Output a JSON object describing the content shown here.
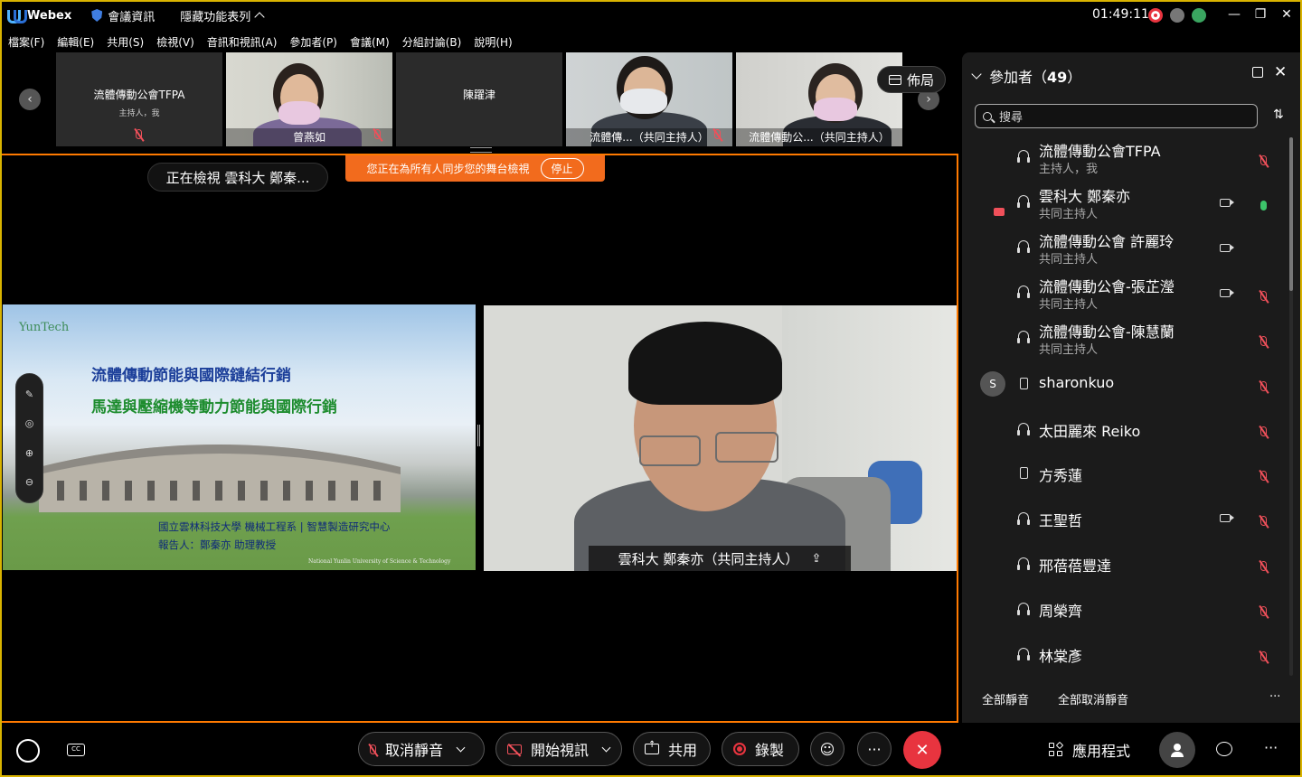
{
  "titlebar": {
    "app_name": "Webex",
    "meeting_info": "會議資訊",
    "hide_menu": "隱藏功能表列",
    "clock": "01:49:11"
  },
  "menu": [
    "檔案(F)",
    "編輯(E)",
    "共用(S)",
    "檢視(V)",
    "音訊和視訊(A)",
    "參加者(P)",
    "會議(M)",
    "分組討論(B)",
    "說明(H)"
  ],
  "thumbnails": [
    {
      "name": "流體傳動公會TFPA",
      "sub": "主持人，我"
    },
    {
      "name": "曾燕如"
    },
    {
      "name": "陳躍津"
    },
    {
      "name": "流體傳...（共同主持人）"
    },
    {
      "name": "流體傳動公...（共同主持人）"
    }
  ],
  "layout_button": "佈局",
  "stage": {
    "viewing_pill": "正在檢視 雲科大 鄭秦...",
    "sync_banner": "您正在為所有人同步您的舞台檢視",
    "stop_label": "停止"
  },
  "slide": {
    "logo": "YunTech",
    "title1": "流體傳動節能與國際鏈結行銷",
    "title2": "馬達與壓縮機等動力節能與國際行銷",
    "info1": "國立雲林科技大學 機械工程系 | 智慧製造研究中心",
    "info2": "報告人：鄭秦亦 助理教授",
    "footer": "National Yunlin University of Science & Technology"
  },
  "video": {
    "name_label": "雲科大 鄭秦亦（共同主持人）"
  },
  "participants": {
    "header": "參加者（",
    "count": "49",
    "header_close": "）",
    "search_placeholder": "搜尋",
    "list": [
      {
        "name": "流體傳動公會TFPA",
        "role": "主持人，我"
      },
      {
        "name": "雲科大 鄭秦亦",
        "role": "共同主持人"
      },
      {
        "name": "流體傳動公會 許麗玲",
        "role": "共同主持人"
      },
      {
        "name": "流體傳動公會-張芷瀅",
        "role": "共同主持人"
      },
      {
        "name": "流體傳動公會-陳慧蘭",
        "role": "共同主持人"
      },
      {
        "name": "sharonkuo",
        "avatar": "S"
      },
      {
        "name": "太田麗來 Reiko"
      },
      {
        "name": "方秀蓮"
      },
      {
        "name": "王聖哲"
      },
      {
        "name": "邢蓓蓓豐達"
      },
      {
        "name": "周榮齊"
      },
      {
        "name": "林棠彥"
      }
    ],
    "mute_all": "全部靜音",
    "unmute_all": "全部取消靜音",
    "more": "···"
  },
  "controls": {
    "unmute": "取消靜音",
    "start_video": "開始視訊",
    "share": "共用",
    "record": "錄製",
    "more": "···",
    "apps": "應用程式",
    "more_right": "···"
  },
  "colors": {
    "stage_border": "#ff7a00",
    "window_border": "#d9b300",
    "end_button": "#e8343f",
    "muted_mic": "#f0505a",
    "banner": "#f26b1d"
  }
}
